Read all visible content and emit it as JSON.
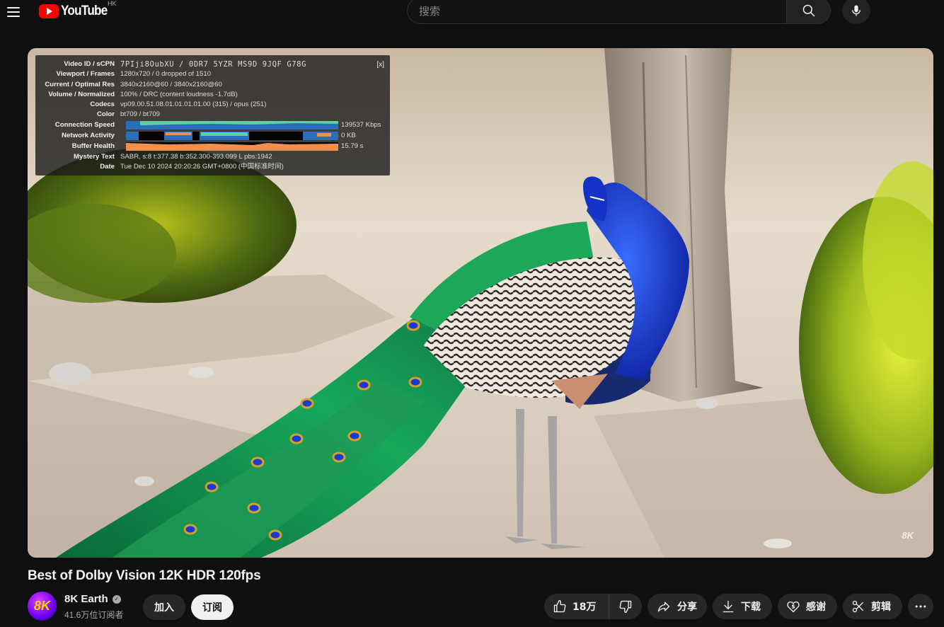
{
  "header": {
    "logo_text": "YouTube",
    "country_code": "HK",
    "search_placeholder": "搜索"
  },
  "stats": {
    "close_label": "[x]",
    "rows": [
      {
        "label": "Video ID / sCPN",
        "value": "7PIji8OubXU / 0DR7 5YZR MS9D 9JQF G78G"
      },
      {
        "label": "Viewport / Frames",
        "value": "1280x720 / 0 dropped of 1510"
      },
      {
        "label": "Current / Optimal Res",
        "value": "3840x2160@60 / 3840x2160@60"
      },
      {
        "label": "Volume / Normalized",
        "value": "100% / DRC (content loudness -1.7dB)"
      },
      {
        "label": "Codecs",
        "value": "vp09.00.51.08.01.01.01.01.00 (315) / opus (251)"
      },
      {
        "label": "Color",
        "value": "bt709 / bt709"
      },
      {
        "label": "Connection Speed",
        "value": "139537 Kbps"
      },
      {
        "label": "Network Activity",
        "value": "0 KB"
      },
      {
        "label": "Buffer Health",
        "value": "15.79 s"
      },
      {
        "label": "Mystery Text",
        "value": "SABR, s:8 t:377.38 b:352.300-393.099 L pbs:1942"
      },
      {
        "label": "Date",
        "value": "Tue Dec 10 2024 20:20:26 GMT+0800 (中国标准时间)"
      }
    ],
    "colors": {
      "connection": "#2a6fbd",
      "connection_top": "#5fd0a0",
      "network": "#2a6fbd",
      "buffer": "#f0904c"
    }
  },
  "video": {
    "watermark": "8K"
  },
  "video_title": "Best of Dolby Vision 12K HDR 120fps",
  "channel": {
    "avatar_text": "8K",
    "name": "8K Earth",
    "subscribers": "41.6万位订阅者",
    "join_label": "加入",
    "subscribe_label": "订阅"
  },
  "actions": {
    "like_count": "18万",
    "share": "分享",
    "download": "下载",
    "thanks": "感谢",
    "clip": "剪辑"
  }
}
